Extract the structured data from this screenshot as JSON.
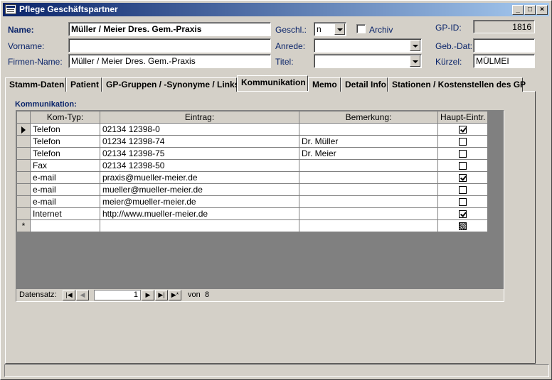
{
  "window": {
    "title": "Pflege Geschäftspartner",
    "minimize": "_",
    "maximize": "□",
    "close": "×"
  },
  "header": {
    "name_label": "Name:",
    "name_value": "Müller / Meier Dres. Gem.-Praxis",
    "vorname_label": "Vorname:",
    "vorname_value": "",
    "firma_label": "Firmen-Name:",
    "firma_value": "Müller / Meier Dres. Gem.-Praxis",
    "geschl_label": "Geschl.:",
    "geschl_value": "n",
    "archiv_label": "Archiv",
    "anrede_label": "Anrede:",
    "anrede_value": "",
    "titel_label": "Titel:",
    "titel_value": "",
    "gpid_label": "GP-ID:",
    "gpid_value": "1816",
    "gebdat_label": "Geb.-Dat:",
    "gebdat_value": "",
    "kuerzel_label": "Kürzel:",
    "kuerzel_value": "MÜLMEI"
  },
  "tabs": [
    {
      "label": "Stamm-Daten"
    },
    {
      "label": "Patient"
    },
    {
      "label": "GP-Gruppen / -Synonyme / Links"
    },
    {
      "label": "Kommunikation"
    },
    {
      "label": "Memo"
    },
    {
      "label": "Detail Info"
    },
    {
      "label": "Stationen / Kostenstellen des GP"
    }
  ],
  "active_tab": "Kommunikation",
  "section_title": "Kommunikation:",
  "grid": {
    "columns": [
      "Kom-Typ:",
      "Eintrag:",
      "Bemerkung:",
      "Haupt-Eintr."
    ],
    "rows": [
      {
        "typ": "Telefon",
        "eintrag": "02134 12398-0",
        "bemerkung": "",
        "haupt": true
      },
      {
        "typ": "Telefon",
        "eintrag": "01234 12398-74",
        "bemerkung": "Dr. Müller",
        "haupt": false
      },
      {
        "typ": "Telefon",
        "eintrag": "02134 12398-75",
        "bemerkung": "Dr. Meier",
        "haupt": false
      },
      {
        "typ": "Fax",
        "eintrag": "02134 12398-50",
        "bemerkung": "",
        "haupt": false
      },
      {
        "typ": "e-mail",
        "eintrag": "praxis@mueller-meier.de",
        "bemerkung": "",
        "haupt": true
      },
      {
        "typ": "e-mail",
        "eintrag": "mueller@mueller-meier.de",
        "bemerkung": "",
        "haupt": false
      },
      {
        "typ": "e-mail",
        "eintrag": "meier@mueller-meier.de",
        "bemerkung": "",
        "haupt": false
      },
      {
        "typ": "Internet",
        "eintrag": "http://www.mueller-meier.de",
        "bemerkung": "",
        "haupt": true
      }
    ],
    "new_row_marker": "*"
  },
  "recnav": {
    "label": "Datensatz:",
    "current": "1",
    "von_label": "von",
    "total": "8",
    "first": "|◀",
    "prev": "◀",
    "next": "▶",
    "last": "▶|",
    "new": "▶*"
  }
}
